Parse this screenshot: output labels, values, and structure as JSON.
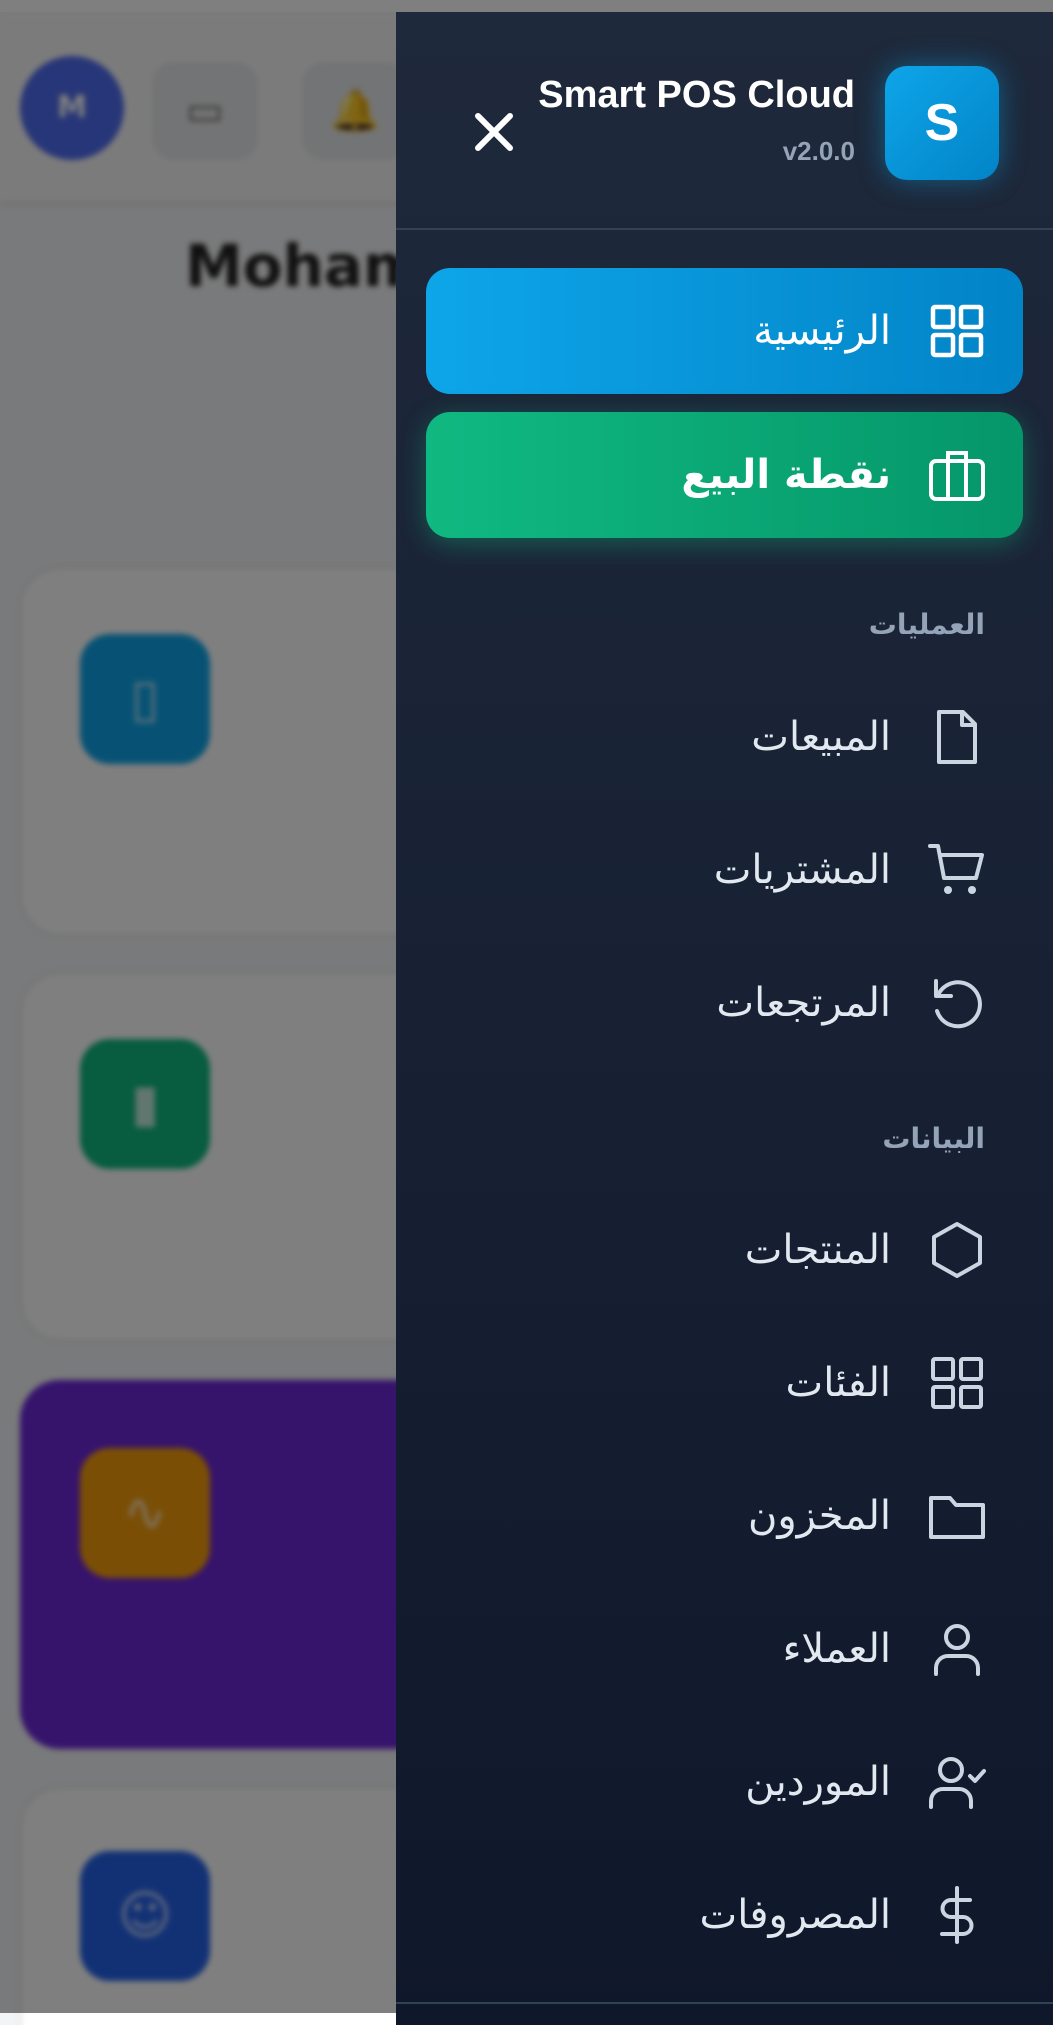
{
  "background": {
    "avatar_letter": "M",
    "user_name": "Moham"
  },
  "drawer": {
    "logo_letter": "S",
    "app_name": "Smart POS Cloud",
    "version": "v2.0.0",
    "close_icon": "close-icon",
    "primary_nav": [
      {
        "label": "الرئيسية",
        "icon": "grid-icon",
        "color": "#0ea5e9"
      },
      {
        "label": "نقطة البيع",
        "icon": "briefcase-icon",
        "color": "#10b981"
      }
    ],
    "sections": [
      {
        "title": "العمليات",
        "items": [
          {
            "label": "المبيعات",
            "icon": "file-icon"
          },
          {
            "label": "المشتريات",
            "icon": "cart-icon"
          },
          {
            "label": "المرتجعات",
            "icon": "rotate-ccw-icon"
          }
        ]
      },
      {
        "title": "البيانات",
        "items": [
          {
            "label": "المنتجات",
            "icon": "hexagon-icon"
          },
          {
            "label": "الفئات",
            "icon": "grid-icon"
          },
          {
            "label": "المخزون",
            "icon": "folder-icon"
          },
          {
            "label": "العملاء",
            "icon": "user-icon"
          },
          {
            "label": "الموردين",
            "icon": "user-check-icon"
          },
          {
            "label": "المصروفات",
            "icon": "dollar-icon"
          }
        ]
      }
    ]
  },
  "colors": {
    "drawer_bg": "#1e293b",
    "accent_blue": "#0ea5e9",
    "accent_green": "#10b981",
    "muted_text": "#94a3b8"
  }
}
